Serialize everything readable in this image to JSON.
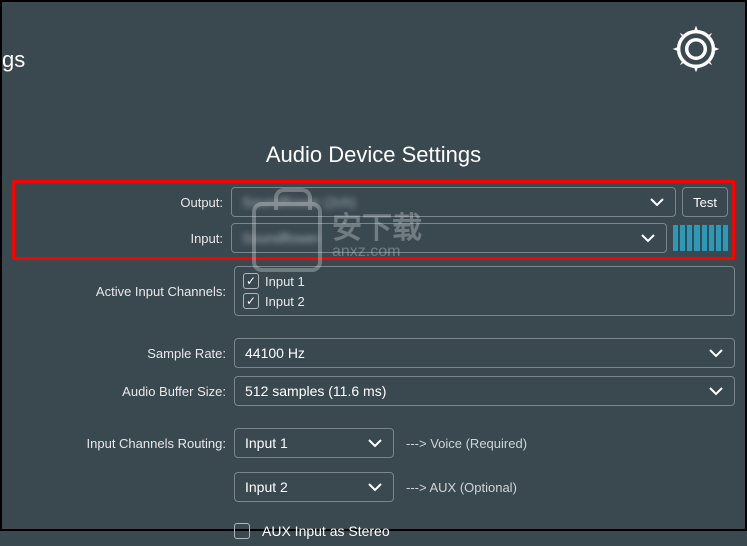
{
  "header": {
    "page_title_fragment": "gs"
  },
  "section": {
    "title": "Audio Device Settings"
  },
  "output": {
    "label": "Output:",
    "value": "Soundflower (2ch)",
    "test_label": "Test"
  },
  "input": {
    "label": "Input:",
    "value": "Soundflower"
  },
  "active_channels": {
    "label": "Active Input Channels:",
    "items": [
      {
        "label": "Input 1",
        "checked": true
      },
      {
        "label": "Input 2",
        "checked": true
      }
    ]
  },
  "sample_rate": {
    "label": "Sample Rate:",
    "value": "44100 Hz"
  },
  "buffer": {
    "label": "Audio Buffer Size:",
    "value": "512 samples (11.6 ms)"
  },
  "routing": {
    "label": "Input Channels Routing:",
    "voice": {
      "value": "Input 1",
      "hint": "---> Voice (Required)"
    },
    "aux": {
      "value": "Input 2",
      "hint": "---> AUX (Optional)"
    }
  },
  "aux_stereo": {
    "label": "AUX Input as Stereo",
    "checked": false
  },
  "watermark": {
    "line1": "安下载",
    "line2": "anxz.com"
  }
}
